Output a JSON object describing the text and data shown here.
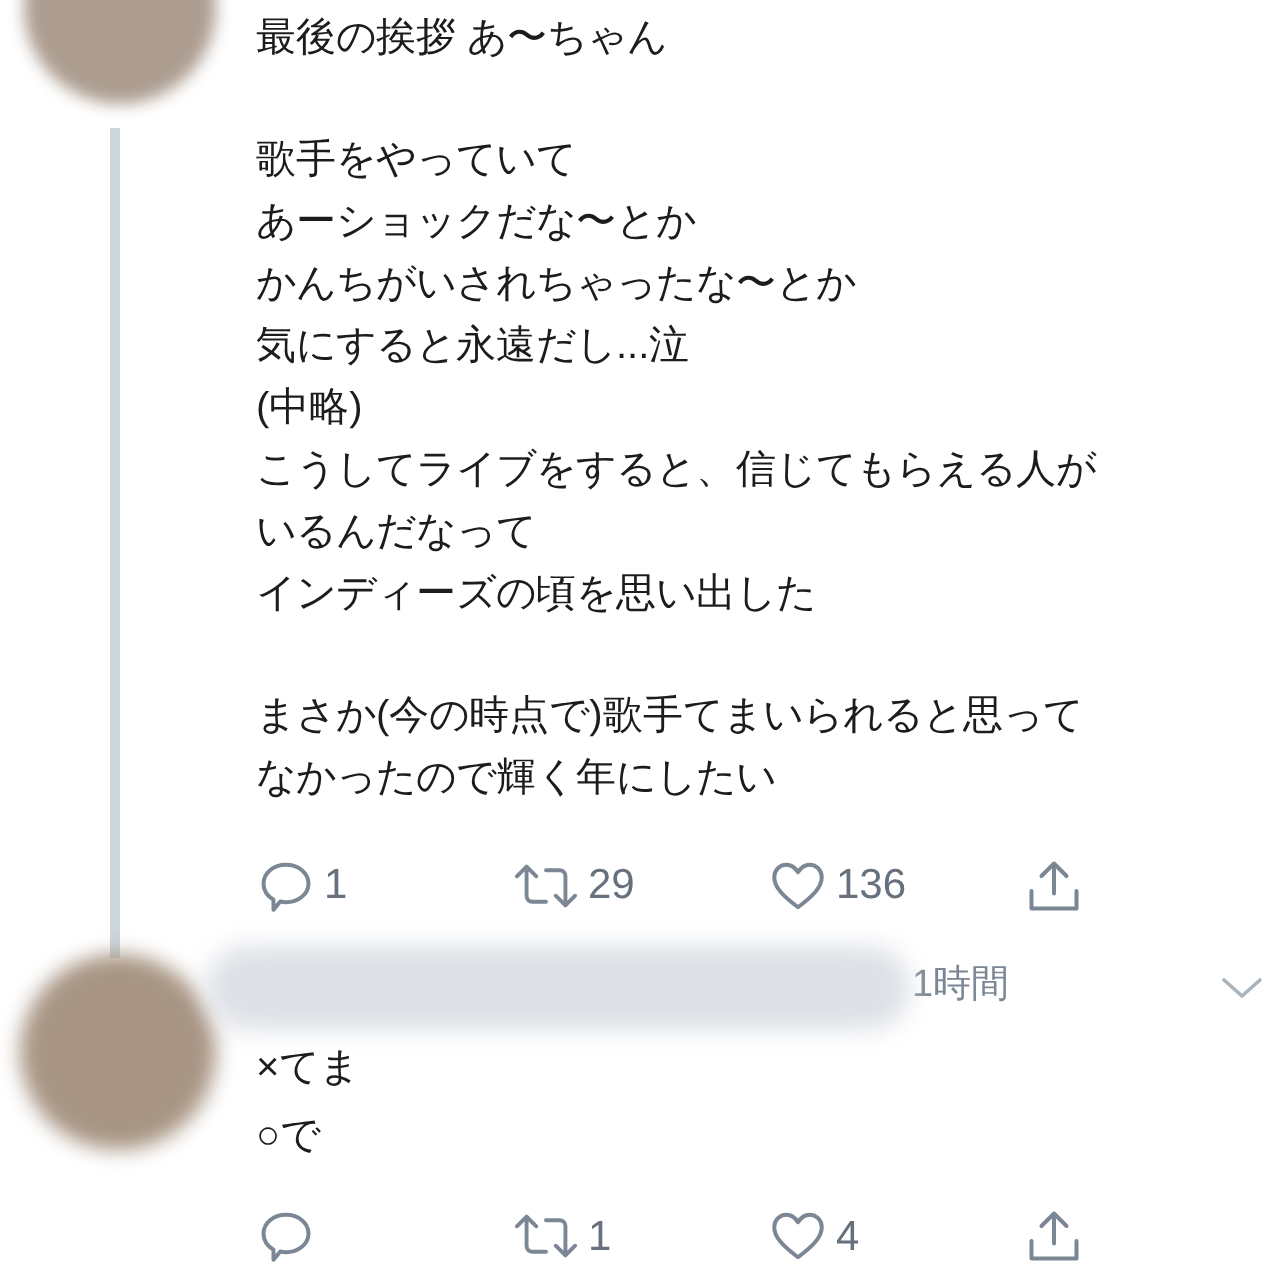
{
  "tweets": [
    {
      "paragraphs": [
        [
          "最後の挨拶 あ〜ちゃん"
        ],
        [
          "歌手をやっていて",
          "あーショックだな〜とか",
          "かんちがいされちゃったな〜とか",
          "気にすると永遠だし...泣",
          "(中略)",
          "こうしてライブをすると、信じてもらえる人が",
          "いるんだなって",
          "インディーズの頃を思い出した"
        ],
        [
          "まさか(今の時点で)歌手てまいられると思って",
          "なかったので輝く年にしたい"
        ]
      ],
      "thread_continues": true,
      "actions": [
        {
          "kind": "reply",
          "count": "1"
        },
        {
          "kind": "retweet",
          "count": "29"
        },
        {
          "kind": "like",
          "count": "136"
        },
        {
          "kind": "share"
        }
      ]
    },
    {
      "name_hidden": true,
      "time": "1時間",
      "menu": true,
      "paragraphs": [
        [
          "×てま",
          "○で"
        ]
      ],
      "thread_continues": false,
      "actions": [
        {
          "kind": "reply"
        },
        {
          "kind": "retweet",
          "count": "1"
        },
        {
          "kind": "like",
          "count": "4"
        },
        {
          "kind": "share"
        }
      ]
    }
  ]
}
